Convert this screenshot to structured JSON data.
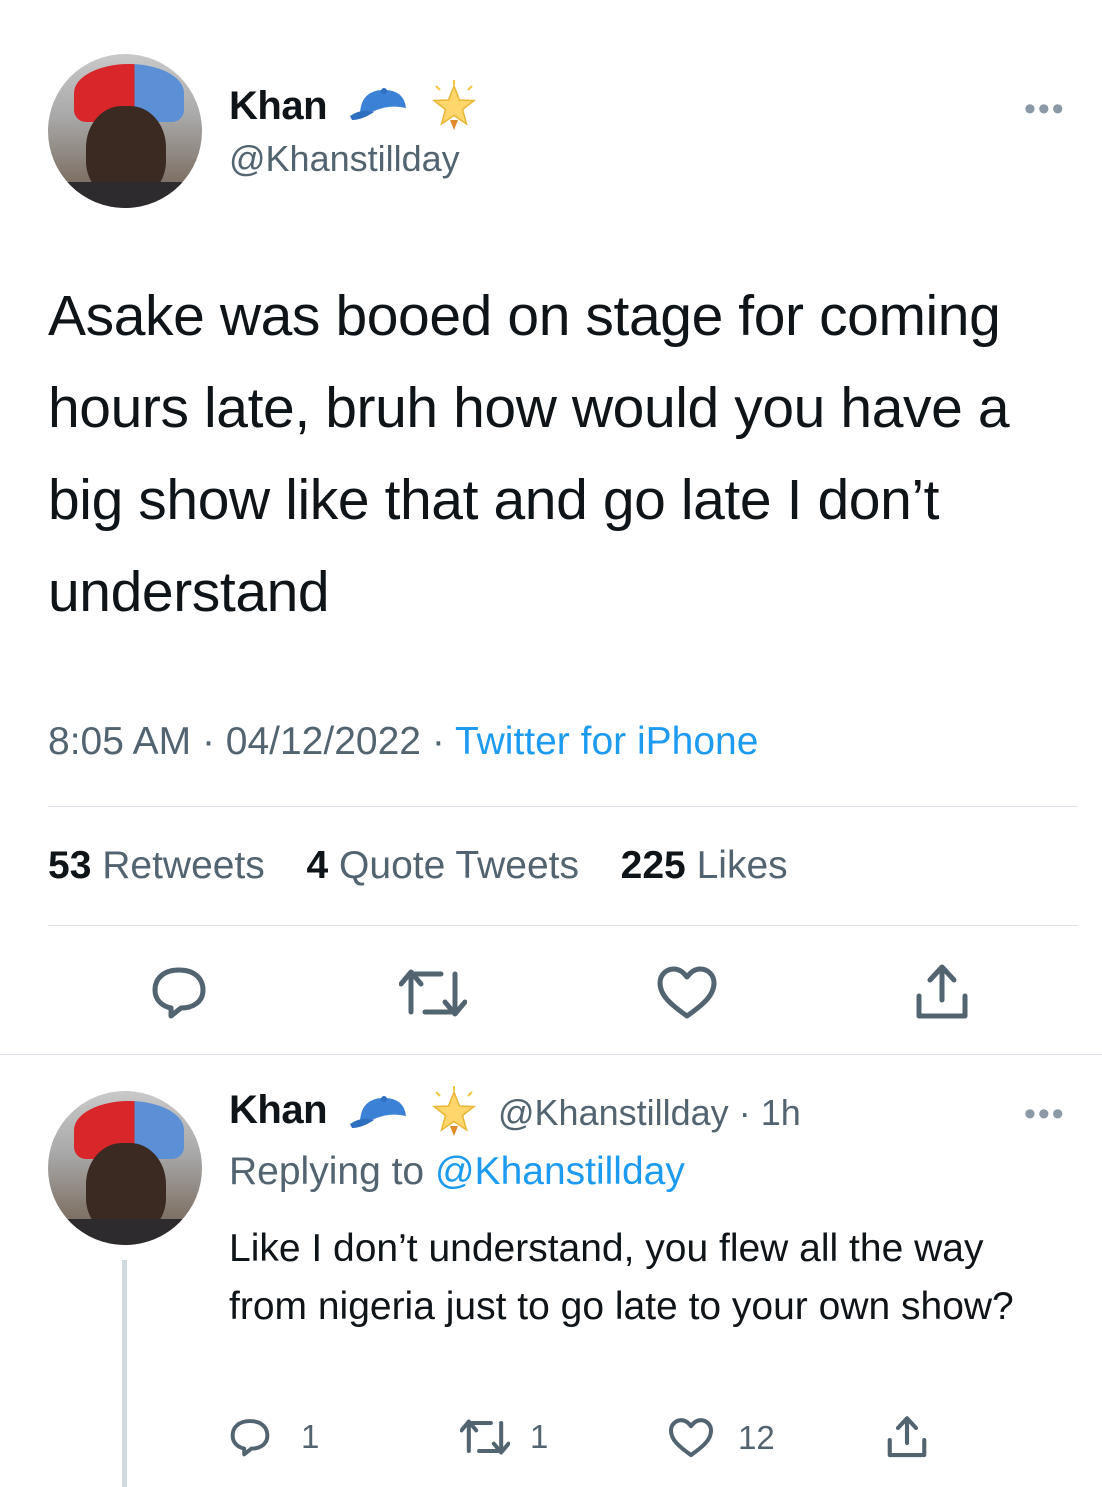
{
  "main_tweet": {
    "author_name": "Khan",
    "author_handle": "@Khanstillday",
    "text": "Asake was booed on stage for coming hours late, bruh how would you have a big show like that and go late I don’t understand",
    "time": "8:05 AM",
    "date": "04/12/2022",
    "source": "Twitter for iPhone",
    "retweets_count": "53",
    "retweets_label": "Retweets",
    "quotes_count": "4",
    "quotes_label": "Quote Tweets",
    "likes_count": "225",
    "likes_label": "Likes",
    "more_label": "•••"
  },
  "reply_tweet": {
    "author_name": "Khan",
    "author_handle": "@Khanstillday",
    "age": "1h",
    "replying_label": "Replying to",
    "replying_to": "@Khanstillday",
    "text": "Like I don’t understand, you flew all the way from nigeria just to go late to your own show?",
    "reply_count": "1",
    "retweet_count": "1",
    "like_count": "12",
    "more_label": "•••"
  },
  "colors": {
    "accent": "#1d9bf0",
    "secondary_text": "#536471",
    "icon": "#536471"
  },
  "icons": [
    "cap-emoji-icon",
    "star-emoji-icon",
    "reply-icon",
    "retweet-icon",
    "like-icon",
    "share-icon"
  ]
}
